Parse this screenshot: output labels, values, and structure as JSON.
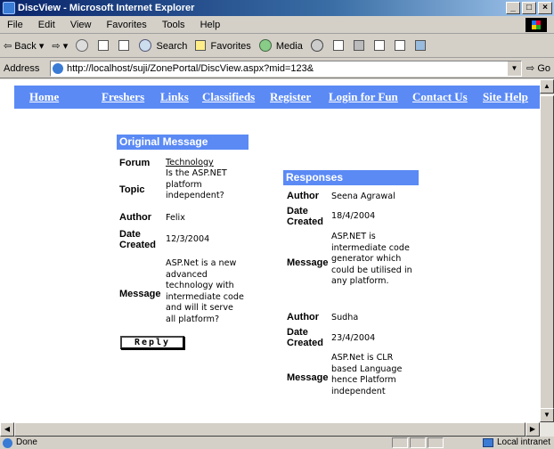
{
  "window": {
    "title": "DiscView - Microsoft Internet Explorer",
    "controls": [
      "_",
      "□",
      "×"
    ]
  },
  "menubar": [
    "File",
    "Edit",
    "View",
    "Favorites",
    "Tools",
    "Help"
  ],
  "toolbar": {
    "back": "Back",
    "search": "Search",
    "favorites": "Favorites",
    "media": "Media"
  },
  "address": {
    "label": "Address",
    "url": "http://localhost/suji/ZonePortal/DiscView.aspx?mid=123&",
    "go": "Go"
  },
  "nav": {
    "links": [
      "Home",
      "Freshers",
      "Links",
      "Classifieds",
      "Register",
      "Login for Fun",
      "Contact Us",
      "Site Help"
    ]
  },
  "original": {
    "heading": "Original Message",
    "forum_label": "Forum",
    "forum": "Technology",
    "topic_label": "Topic",
    "topic_lines": [
      "Is the ASP.NET",
      "platform",
      "independent?"
    ],
    "author_label": "Author",
    "author": "Felix",
    "date_label": [
      "Date",
      "Created"
    ],
    "date": "12/3/2004",
    "message_label": "Message",
    "message_lines": [
      "ASP.Net is a new",
      "advanced",
      "technology with",
      "intermediate code",
      "and will it serve",
      "all platform?"
    ],
    "reply_label": "Reply"
  },
  "responses": {
    "heading": "Responses",
    "items": [
      {
        "author_label": "Author",
        "author": "Seena Agrawal",
        "date_label": [
          "Date",
          "Created"
        ],
        "date": "18/4/2004",
        "message_label": "Message",
        "message_lines": [
          "ASP.NET is",
          "intermediate code",
          "generator which",
          "could be utilised in",
          "any platform."
        ]
      },
      {
        "author_label": "Author",
        "author": "Sudha",
        "date_label": [
          "Date",
          "Created"
        ],
        "date": "23/4/2004",
        "message_label": "Message",
        "message_lines": [
          "ASP.Net is CLR",
          "based Language",
          "hence Platform",
          "independent"
        ]
      }
    ]
  },
  "status": {
    "text": "Done",
    "zone": "Local intranet"
  },
  "colors": {
    "nav_bg": "#5b8af5",
    "header_bg": "#5b8af5"
  }
}
